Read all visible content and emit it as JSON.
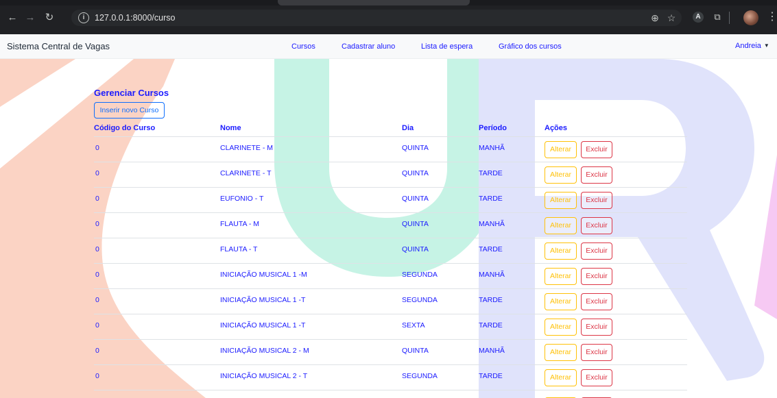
{
  "browser": {
    "url": "127.0.0.1:8000/curso",
    "icons": [
      "back-arrow-icon",
      "forward-arrow-icon",
      "reload-icon",
      "site-info-icon",
      "zoom-icon",
      "bookmark-star-icon",
      "extension-a-icon",
      "extensions-puzzle-icon",
      "profile-avatar",
      "menu-dots-icon"
    ]
  },
  "navbar": {
    "brand": "Sistema Central de Vagas",
    "links": [
      "Cursos",
      "Cadastrar aluno",
      "Lista de espera",
      "Gráfico dos cursos"
    ],
    "user": "Andreia"
  },
  "main": {
    "title": "Gerenciar Cursos",
    "new_button": "Inserir novo Curso",
    "columns": [
      "Código do Curso",
      "Nome",
      "Dia",
      "Período",
      "Ações"
    ],
    "rows": [
      {
        "codigo": "0",
        "nome": "CLARINETE - M",
        "dia": "QUINTA",
        "periodo": "MANHÃ"
      },
      {
        "codigo": "0",
        "nome": "CLARINETE - T",
        "dia": "QUINTA",
        "periodo": "TARDE"
      },
      {
        "codigo": "0",
        "nome": "EUFONIO - T",
        "dia": "QUINTA",
        "periodo": "TARDE"
      },
      {
        "codigo": "0",
        "nome": "FLAUTA - M",
        "dia": "QUINTA",
        "periodo": "MANHÃ"
      },
      {
        "codigo": "0",
        "nome": "FLAUTA - T",
        "dia": "QUINTA",
        "periodo": "TARDE"
      },
      {
        "codigo": "0",
        "nome": "INICIAÇÃO MUSICAL 1 -M",
        "dia": "SEGUNDA",
        "periodo": "MANHÃ"
      },
      {
        "codigo": "0",
        "nome": "INICIAÇÃO MUSICAL 1 -T",
        "dia": "SEGUNDA",
        "periodo": "TARDE"
      },
      {
        "codigo": "0",
        "nome": "INICIAÇÃO MUSICAL 1 -T",
        "dia": "SEXTA",
        "periodo": "TARDE"
      },
      {
        "codigo": "0",
        "nome": "INICIAÇÃO MUSICAL 2 - M",
        "dia": "QUINTA",
        "periodo": "MANHÃ"
      },
      {
        "codigo": "0",
        "nome": "INICIAÇÃO MUSICAL 2 - T",
        "dia": "SEGUNDA",
        "periodo": "TARDE"
      }
    ],
    "actions": {
      "edit": "Alterar",
      "delete": "Excluir"
    }
  },
  "colors": {
    "accent_text": "#1a1aff",
    "edit_button": "#ffc107",
    "delete_button": "#dc3545",
    "new_button": "#0d6efd",
    "bg_logo_orange": "#fbd3c4",
    "bg_logo_mint": "#c6f3e5",
    "bg_logo_lavender": "#e0e3fb",
    "bg_logo_pink": "#f6c9f3"
  }
}
